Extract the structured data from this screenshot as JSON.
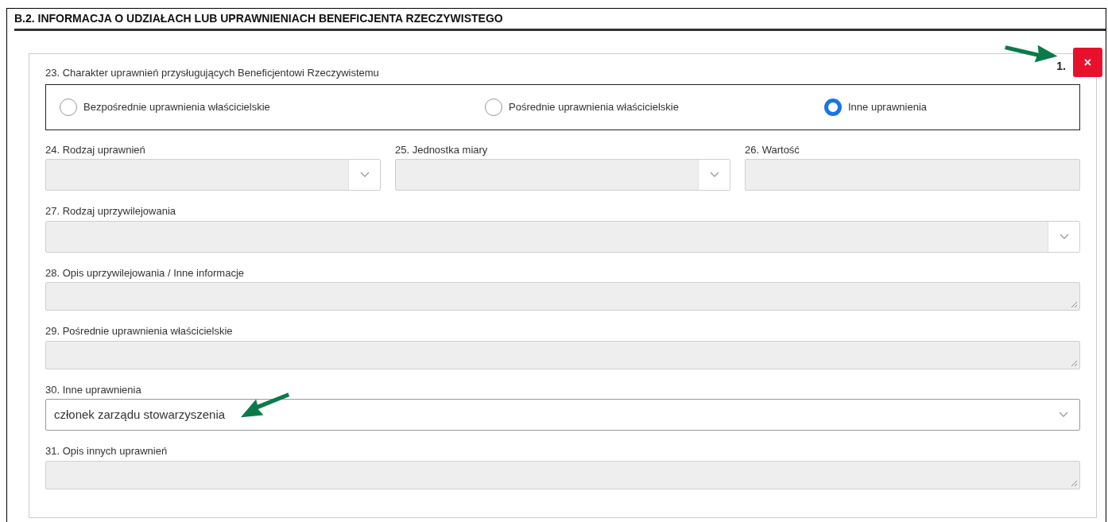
{
  "section_title": "B.2. INFORMACJA O UDZIAŁACH LUB UPRAWNIENIACH BENEFICJENTA RZECZYWISTEGO",
  "entry": {
    "number": "1.",
    "remove_label": "×"
  },
  "rights_group": {
    "label": "23. Charakter uprawnień przysługujących Beneficjentowi Rzeczywistemu",
    "options": [
      {
        "label": "Bezpośrednie uprawnienia właścicielskie",
        "selected": false
      },
      {
        "label": "Pośrednie uprawnienia właścicielskie",
        "selected": false
      },
      {
        "label": "Inne uprawnienia",
        "selected": true
      }
    ]
  },
  "rows": [
    [
      {
        "label": "24. Rodzaj uprawnień",
        "kind": "select",
        "disabled": true
      },
      {
        "label": "25. Jednostka miary",
        "kind": "select",
        "disabled": true
      },
      {
        "label": "26. Wartość",
        "kind": "text",
        "disabled": true
      }
    ],
    [
      {
        "label": "27. Rodzaj uprzywilejowania",
        "kind": "select",
        "disabled": true
      }
    ],
    [
      {
        "label": "28. Opis uprzywilejowania / Inne informacje",
        "kind": "textarea",
        "disabled": true
      }
    ],
    [
      {
        "label": "29. Pośrednie uprawnienia właścicielskie",
        "kind": "textarea",
        "disabled": true
      }
    ],
    [
      {
        "label": "30. Inne uprawnienia",
        "kind": "select",
        "disabled": false,
        "value": "członek zarządu stowarzyszenia"
      }
    ],
    [
      {
        "label": "31. Opis innych uprawnień",
        "kind": "textarea",
        "disabled": true
      }
    ]
  ]
}
